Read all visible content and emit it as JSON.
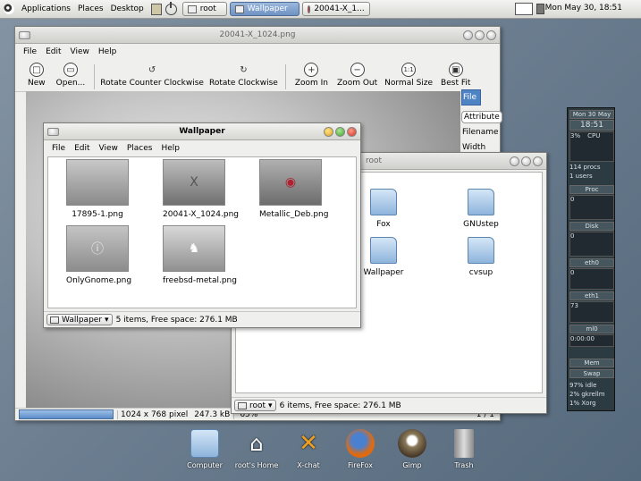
{
  "panel": {
    "menus": [
      "Applications",
      "Places",
      "Desktop"
    ],
    "tasks": [
      {
        "label": "root",
        "active": false
      },
      {
        "label": "Wallpaper",
        "active": true
      },
      {
        "label": "20041-X_1...",
        "active": false
      }
    ],
    "clock": "Mon May 30, 18:51"
  },
  "viewer": {
    "title": "20041-X_1024.png",
    "menus": [
      "File",
      "Edit",
      "View",
      "Help"
    ],
    "toolbar": [
      {
        "label": "New",
        "icon": "new-icon"
      },
      {
        "label": "Open...",
        "icon": "open-icon"
      },
      {
        "label": "Rotate Counter Clockwise",
        "icon": "rotate-ccw-icon"
      },
      {
        "label": "Rotate Clockwise",
        "icon": "rotate-cw-icon"
      },
      {
        "label": "Zoom In",
        "icon": "zoom-in-icon"
      },
      {
        "label": "Zoom Out",
        "icon": "zoom-out-icon"
      },
      {
        "label": "Normal Size",
        "icon": "normal-size-icon"
      },
      {
        "label": "Best Fit",
        "icon": "best-fit-icon"
      }
    ],
    "side": {
      "tab": "File",
      "items": [
        "Attribute",
        "Filename",
        "Width"
      ]
    },
    "status": {
      "dims": "1024 x 768 pixel",
      "size": "247.3 kB",
      "zoom": "65%",
      "pages": "1 / 1"
    }
  },
  "wallpaper": {
    "title": "Wallpaper",
    "menus": [
      "File",
      "Edit",
      "View",
      "Places",
      "Help"
    ],
    "files": [
      "17895-1.png",
      "20041-X_1024.png",
      "Metallic_Deb.png",
      "OnlyGnome.png",
      "freebsd-metal.png"
    ],
    "location": "Wallpaper",
    "status": "5 items, Free space: 276.1 MB"
  },
  "rootwin": {
    "title": "root",
    "folders": [
      "Fox",
      "GNUstep",
      "Wallpaper",
      "cvsup"
    ],
    "location": "root",
    "status": "6 items, Free space: 276.1 MB"
  },
  "dock": [
    {
      "label": "Computer",
      "icon": "computer-icon"
    },
    {
      "label": "root's Home",
      "icon": "home-icon"
    },
    {
      "label": "X-chat",
      "icon": "xchat-icon"
    },
    {
      "label": "FireFox",
      "icon": "firefox-icon"
    },
    {
      "label": "Gimp",
      "icon": "gimp-icon"
    },
    {
      "label": "Trash",
      "icon": "trash-icon"
    }
  ],
  "gkrellm": {
    "date": "Mon 30 May",
    "time": "18:51",
    "cpu": "CPU",
    "cpu_pct": "3%",
    "procs": "114 procs",
    "users": "1 users",
    "proc_label": "Proc",
    "disk": "Disk",
    "eth0": "eth0",
    "eth1": "eth1",
    "eth1_val": "73",
    "ml0": "ml0",
    "ml0_val": "0:00:00",
    "mem": "Mem",
    "swap": "Swap",
    "idle": "97% idle",
    "nice": "2% gkrellm",
    "xorg": "1% Xorg"
  }
}
